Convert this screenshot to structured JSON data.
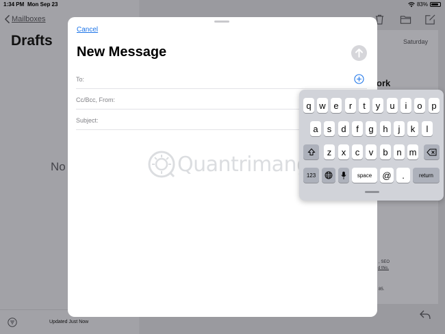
{
  "status_bar": {
    "time": "1:34 PM",
    "date": "Mon Sep 23",
    "battery": "83%",
    "battery_level": 0.83
  },
  "mailboxes": {
    "back_label": "Mailboxes",
    "title": "Drafts",
    "empty_text": "No",
    "updated_text": "Updated Just Now"
  },
  "message_pane": {
    "date_label": "Saturday",
    "subject_fragment": "ork",
    "body_fragments": [
      ", SEO",
      "d this.",
      "85."
    ]
  },
  "compose": {
    "cancel_label": "Cancel",
    "title": "New Message",
    "fields": [
      {
        "label": "To:"
      },
      {
        "label": "Cc/Bcc, From:"
      },
      {
        "label": "Subject:"
      }
    ]
  },
  "watermark": {
    "text": "Quantrimang"
  },
  "keyboard": {
    "row1": [
      "q",
      "w",
      "e",
      "r",
      "t",
      "y",
      "u",
      "i",
      "o",
      "p"
    ],
    "row2": [
      "a",
      "s",
      "d",
      "f",
      "g",
      "h",
      "j",
      "k",
      "l"
    ],
    "row3": [
      "z",
      "x",
      "c",
      "v",
      "b",
      "n",
      "m"
    ],
    "numbers_label": "123",
    "space_label": "space",
    "at_label": "@",
    "period_label": ".",
    "return_label": "return"
  },
  "colors": {
    "accent": "#1a73e8",
    "keyboard_bg": "#d1d3d9",
    "dim_overlay": "#9c9ca1"
  },
  "icons": {
    "status": [
      "wifi-icon",
      "battery-icon"
    ],
    "toolbar": [
      "trash-icon",
      "folder-icon",
      "compose-icon"
    ],
    "compose": [
      "send-arrow-icon",
      "add-contact-icon"
    ],
    "keyboard": [
      "shift-icon",
      "delete-icon",
      "globe-icon",
      "microphone-icon"
    ]
  }
}
